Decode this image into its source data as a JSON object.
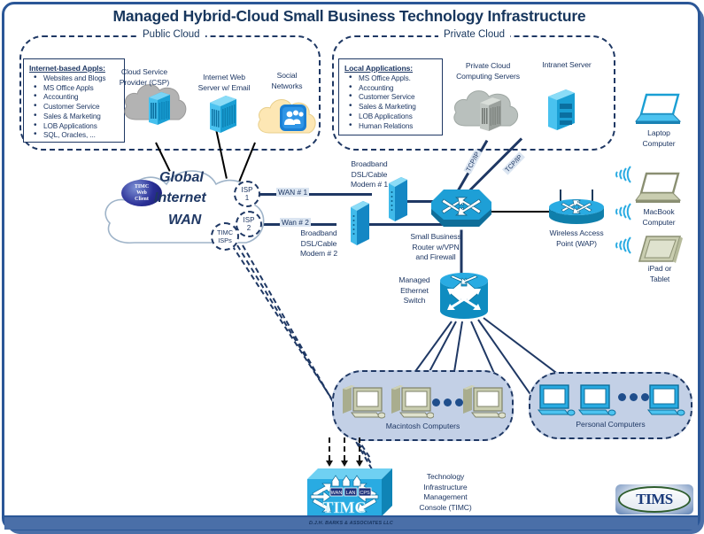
{
  "title": "Managed Hybrid-Cloud Small Business Technology Infrastructure",
  "zones": {
    "public_cloud": "Public Cloud",
    "private_cloud": "Private Cloud"
  },
  "panels": {
    "internet_apps": {
      "heading": "Internet-based Appls:",
      "items": [
        "Websites and Blogs",
        "MS Office Appls",
        "Accounting",
        "Customer Service",
        "Sales & Marketing",
        "LOB Applications",
        "SQL, Oracles, ..."
      ]
    },
    "local_apps": {
      "heading": "Local Applications:",
      "items": [
        "MS Office Appls.",
        "Accounting",
        "Customer Service",
        "Sales & Marketing",
        "LOB Applications",
        "Human Relations"
      ]
    }
  },
  "nodes": {
    "csp": "Cloud Service\nProvider (CSP)",
    "csp_l1": "Cloud Service",
    "csp_l2": "Provider (CSP)",
    "web_server_l1": "Internet Web",
    "web_server_l2": "Server w/ Email",
    "social_l1": "Social",
    "social_l2": "Networks",
    "private_servers_l1": "Private Cloud",
    "private_servers_l2": "Computing Servers",
    "intranet_server": "Intranet Server",
    "internet_wan_l1": "Global",
    "internet_wan_l2": "Internet",
    "internet_wan_l3": "WAN",
    "web_client_l1": "TIMC",
    "web_client_l2": "Web",
    "web_client_l3": "Client",
    "isp1_l1": "ISP",
    "isp1_l2": "1",
    "isp2_l1": "ISP",
    "isp2_l2": "2",
    "timc_isps_l1": "TIMC",
    "timc_isps_l2": "ISPs",
    "modem1_l1": "Broadband",
    "modem1_l2": "DSL/Cable",
    "modem1_l3": "Modem # 1",
    "modem2_l1": "Broadband",
    "modem2_l2": "DSL/Cable",
    "modem2_l3": "Modem # 2",
    "router_l1": "Small Business",
    "router_l2": "Router w/VPN",
    "router_l3": "and Firewall",
    "switch_l1": "Managed",
    "switch_l2": "Ethernet",
    "switch_l3": "Switch",
    "wap_l1": "Wireless Access",
    "wap_l2": "Point (WAP)",
    "laptop_l1": "Laptop",
    "laptop_l2": "Computer",
    "macbook_l1": "MacBook",
    "macbook_l2": "Computer",
    "ipad_l1": "iPad or",
    "ipad_l2": "Tablet",
    "mac_group": "Macintosh Computers",
    "pc_group": "Personal Computers",
    "timc_console_l1": "Technology",
    "timc_console_l2": "Infrastructure",
    "timc_console_l3": "Management",
    "timc_console_l4": "Console (TIMC)",
    "timc_box_label": "TIMC",
    "timc_port_wan": "WAN",
    "timc_port_lan": "LAN",
    "timc_port_cps": "CPS"
  },
  "links": {
    "wan1": "WAN # 1",
    "wan2": "Wan # 2",
    "tcpip_a": "TCP/IP",
    "tcpip_b": "TCP/IP"
  },
  "footer": {
    "credit": "D.J.H. BARKS & ASSOCIATES LLC",
    "logo": "TIMS"
  },
  "colors": {
    "frame": "#2b5797",
    "title": "#17365d",
    "link": "#1f3864",
    "group_fill": "#c3d0e6",
    "device_blue": "#29abe2",
    "wifi": "#29abe2"
  }
}
